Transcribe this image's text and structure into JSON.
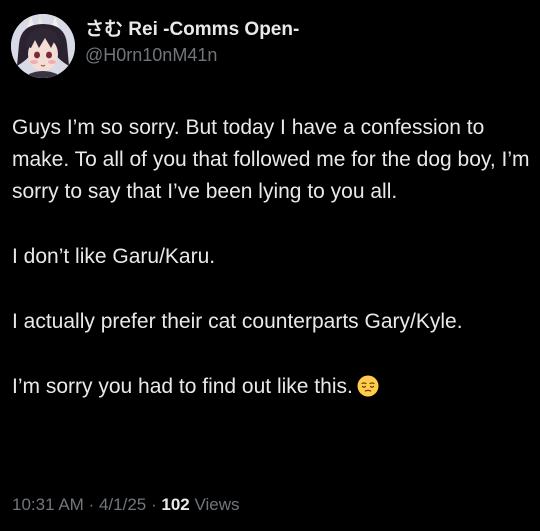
{
  "author": {
    "display_name": "さむ Rei -Comms Open-",
    "handle": "@H0rn10nM41n"
  },
  "tweet": {
    "paragraphs": [
      "Guys I’m so sorry. But today I have a confession to make. To all of you that followed me for the dog boy, I’m sorry to say that I’ve been lying to you all.",
      "I don’t like Garu/Karu.",
      "I actually prefer their cat counterparts Gary/Kyle.",
      "I’m sorry you had to find out like this."
    ],
    "emoji": "pensive-face-icon"
  },
  "meta": {
    "time": "10:31 AM",
    "separator": "·",
    "date": "4/1/25",
    "views_count": "102",
    "views_label": "Views"
  },
  "colors": {
    "background": "#000000",
    "primary_text": "#e7e9ea",
    "secondary_text": "#71767b"
  }
}
